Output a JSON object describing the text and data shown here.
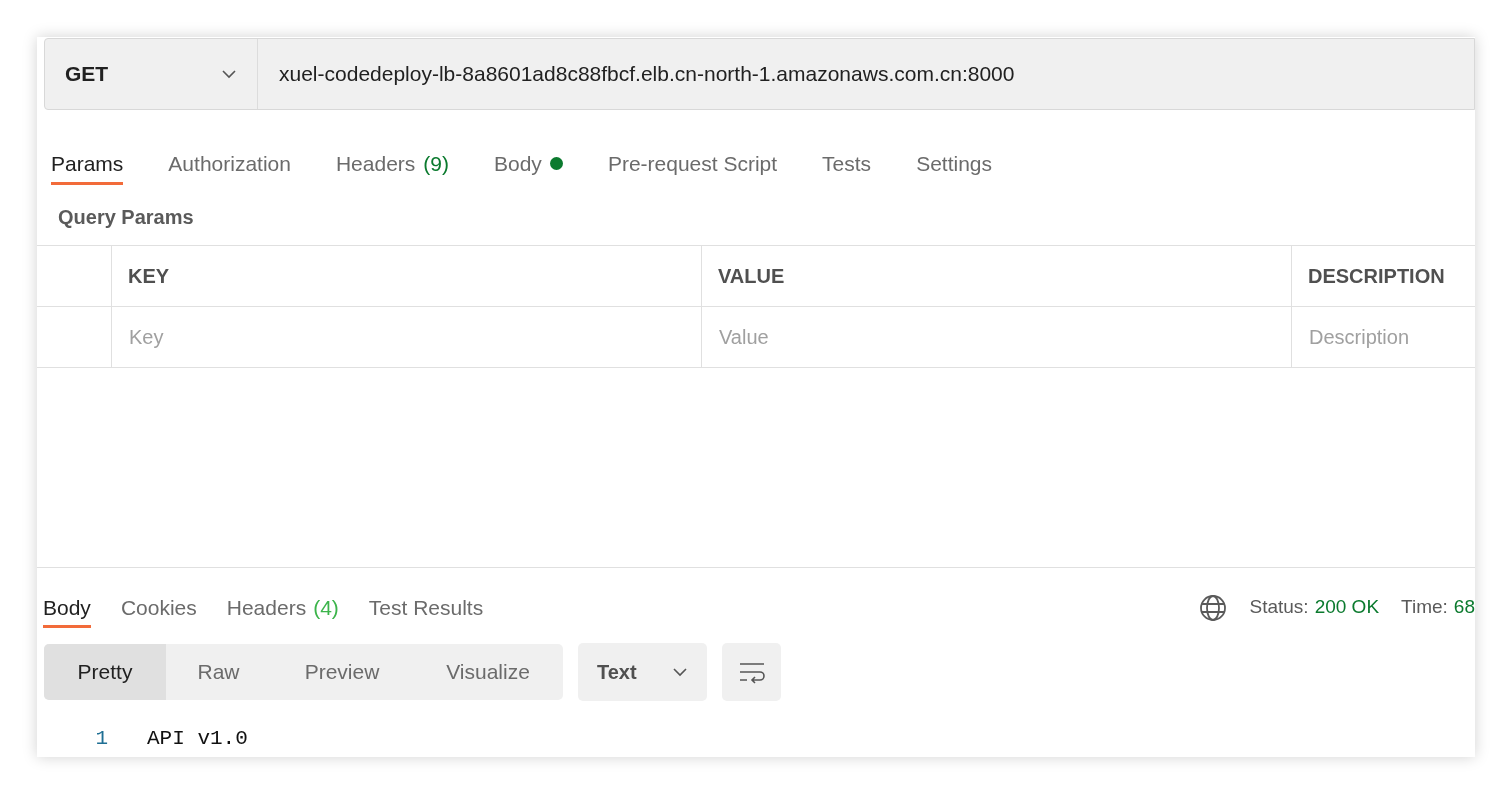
{
  "request": {
    "method": "GET",
    "url": "xuel-codedeploy-lb-8a8601ad8c88fbcf.elb.cn-north-1.amazonaws.com.cn:8000"
  },
  "request_tabs": [
    {
      "label": "Params",
      "selected": true
    },
    {
      "label": "Authorization",
      "selected": false
    },
    {
      "label": "Headers",
      "count": "(9)",
      "selected": false
    },
    {
      "label": "Body",
      "has_content": true,
      "selected": false
    },
    {
      "label": "Pre-request Script",
      "selected": false
    },
    {
      "label": "Tests",
      "selected": false
    },
    {
      "label": "Settings",
      "selected": false
    }
  ],
  "query_params": {
    "title": "Query Params",
    "columns": [
      "KEY",
      "VALUE",
      "DESCRIPTION"
    ],
    "placeholders": [
      "Key",
      "Value",
      "Description"
    ]
  },
  "response": {
    "tabs": [
      {
        "label": "Body",
        "selected": true
      },
      {
        "label": "Cookies",
        "selected": false
      },
      {
        "label": "Headers",
        "count": "(4)",
        "selected": false
      },
      {
        "label": "Test Results",
        "selected": false
      }
    ],
    "status_label": "Status:",
    "status_value": "200 OK",
    "time_label": "Time:",
    "time_value": "68",
    "view_modes": [
      {
        "label": "Pretty",
        "selected": true
      },
      {
        "label": "Raw",
        "selected": false
      },
      {
        "label": "Preview",
        "selected": false
      },
      {
        "label": "Visualize",
        "selected": false
      }
    ],
    "format": "Text",
    "lines": [
      {
        "number": "1",
        "text": "API v1.0"
      }
    ]
  }
}
